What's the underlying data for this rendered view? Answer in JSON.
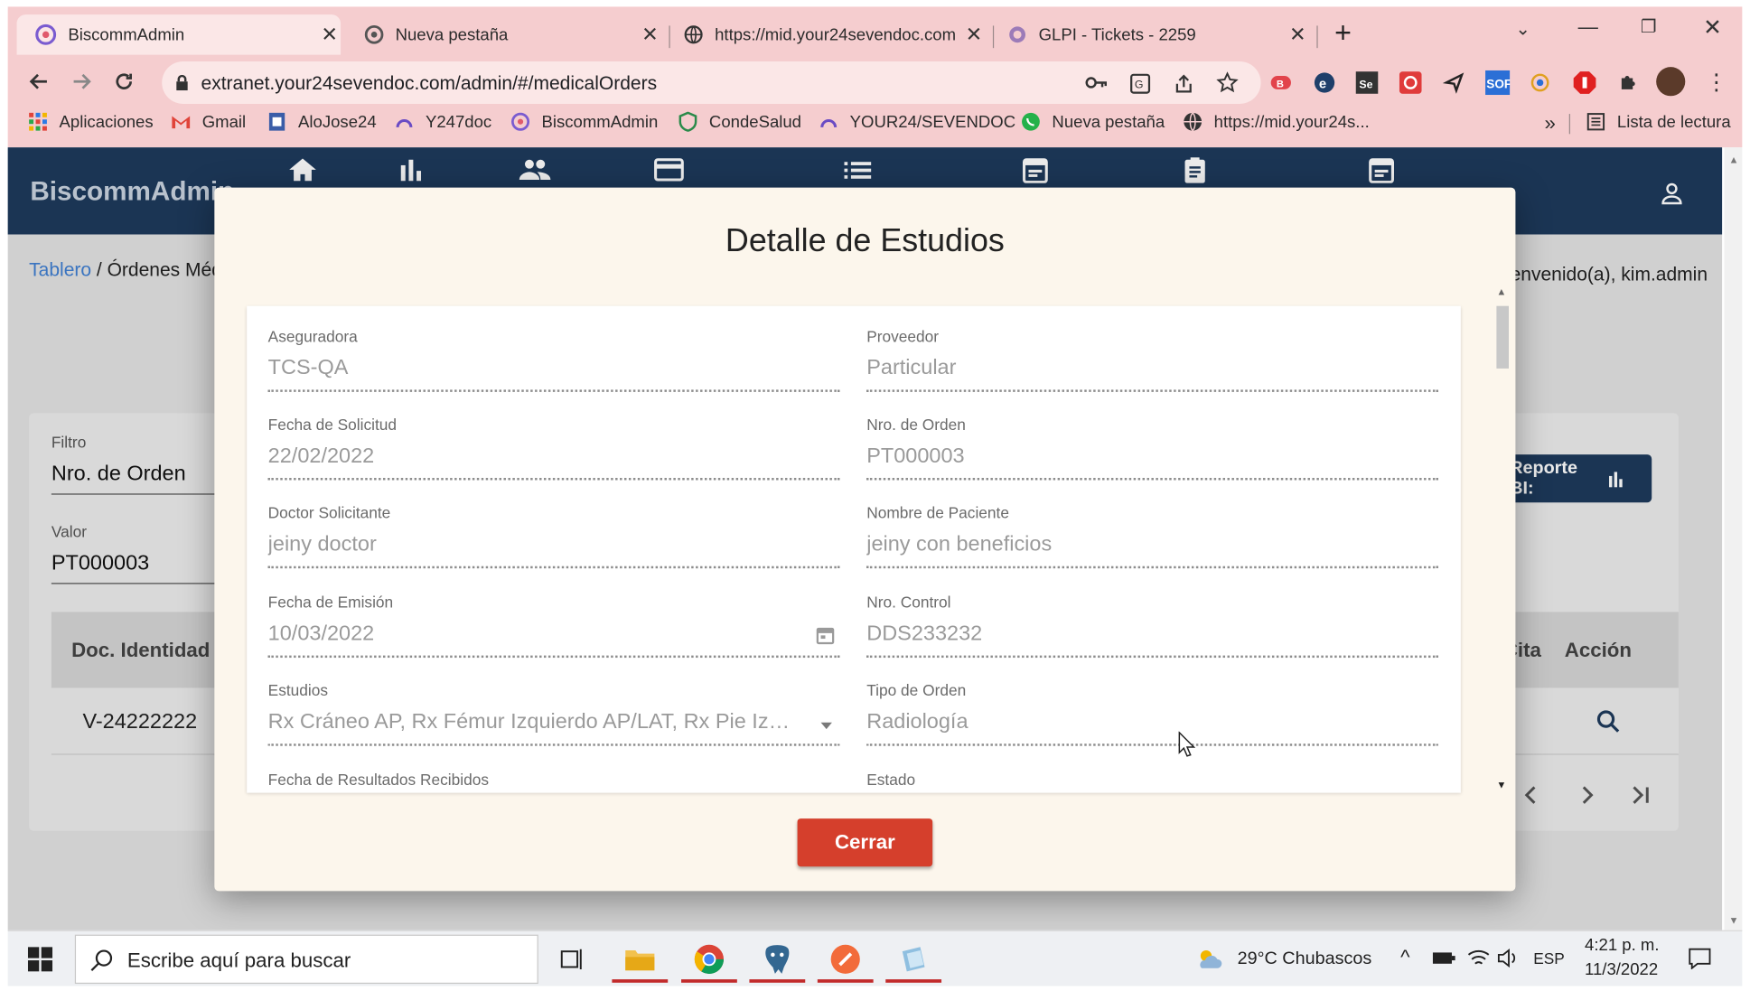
{
  "browser": {
    "tabs": [
      {
        "label": "BiscommAdmin",
        "active": true
      },
      {
        "label": "Nueva pestaña",
        "active": false
      },
      {
        "label": "https://mid.your24sevendoc.com",
        "active": false
      },
      {
        "label": "GLPI - Tickets - 2259",
        "active": false
      }
    ],
    "new_tab": "+",
    "url": "extranet.your24sevendoc.com/admin/#/medicalOrders",
    "bookmarks": [
      {
        "label": "Aplicaciones",
        "icon": "apps-grid-icon"
      },
      {
        "label": "Gmail",
        "icon": "gmail-icon"
      },
      {
        "label": "AloJose24",
        "icon": "page-icon"
      },
      {
        "label": "Y247doc",
        "icon": "biscomm-icon"
      },
      {
        "label": "BiscommAdmin",
        "icon": "biscomm-icon"
      },
      {
        "label": "CondeSalud",
        "icon": "shield-logo-icon"
      },
      {
        "label": "YOUR24/SEVENDOC",
        "icon": "biscomm-icon"
      },
      {
        "label": "Nueva pestaña",
        "icon": "whatsapp-icon"
      },
      {
        "label": "https://mid.your24s...",
        "icon": "globe-icon"
      }
    ],
    "more_bookmarks": "»",
    "reading_list": "Lista de lectura"
  },
  "app": {
    "brand": "BiscommAdmin",
    "nav_icons": [
      "home-icon",
      "bar-chart-icon",
      "people-icon",
      "credit-card-icon",
      "list-icon",
      "calendar-icon",
      "clipboard-icon",
      "calendar-icon"
    ],
    "breadcrumb_link": "Tablero",
    "breadcrumb_sep": " / ",
    "breadcrumb_current": "Órdenes Médicas",
    "welcome": "Bienvenido(a), kim.admin",
    "filter_label": "Filtro",
    "filter_value": "Nro. de Orden",
    "value_label": "Valor",
    "value_value": "PT000003",
    "report_button": "Reporte BI:",
    "table_headers": {
      "first": "Doc. Identidad",
      "partial": "Cita",
      "action": "Acción"
    },
    "row": {
      "doc": "V-24222222"
    }
  },
  "modal": {
    "title": "Detalle de Estudios",
    "fields": [
      {
        "label": "Aseguradora",
        "value": "TCS-QA"
      },
      {
        "label": "Proveedor",
        "value": "Particular"
      },
      {
        "label": "Fecha de Solicitud",
        "value": "22/02/2022"
      },
      {
        "label": "Nro. de Orden",
        "value": "PT000003"
      },
      {
        "label": "Doctor Solicitante",
        "value": "jeiny doctor"
      },
      {
        "label": "Nombre de Paciente",
        "value": "jeiny con beneficios"
      },
      {
        "label": "Fecha de Emisión",
        "value": "10/03/2022",
        "suffix": "calendar-icon"
      },
      {
        "label": "Nro. Control",
        "value": "DDS233232"
      },
      {
        "label": "Estudios",
        "value": "Rx Cráneo AP, Rx Fémur Izquierdo AP/LAT, Rx Pie Izquierdo",
        "suffix": "dropdown-arrow-icon"
      },
      {
        "label": "Tipo de Orden",
        "value": "Radiología"
      },
      {
        "label": "Fecha de Resultados Recibidos",
        "value": ""
      },
      {
        "label": "Estado",
        "value": ""
      }
    ],
    "close_button": "Cerrar"
  },
  "taskbar": {
    "search_placeholder": "Escribe aquí para buscar",
    "weather": "29°C  Chubascos",
    "language": "ESP",
    "time": "4:21 p. m.",
    "date": "11/3/2022"
  },
  "colors": {
    "header": "#1e3a5c",
    "accent_red": "#d53f2c",
    "chrome_pink": "#f5cdcf",
    "modal_bg": "#fcf6ec",
    "link": "#3f7ed1"
  }
}
